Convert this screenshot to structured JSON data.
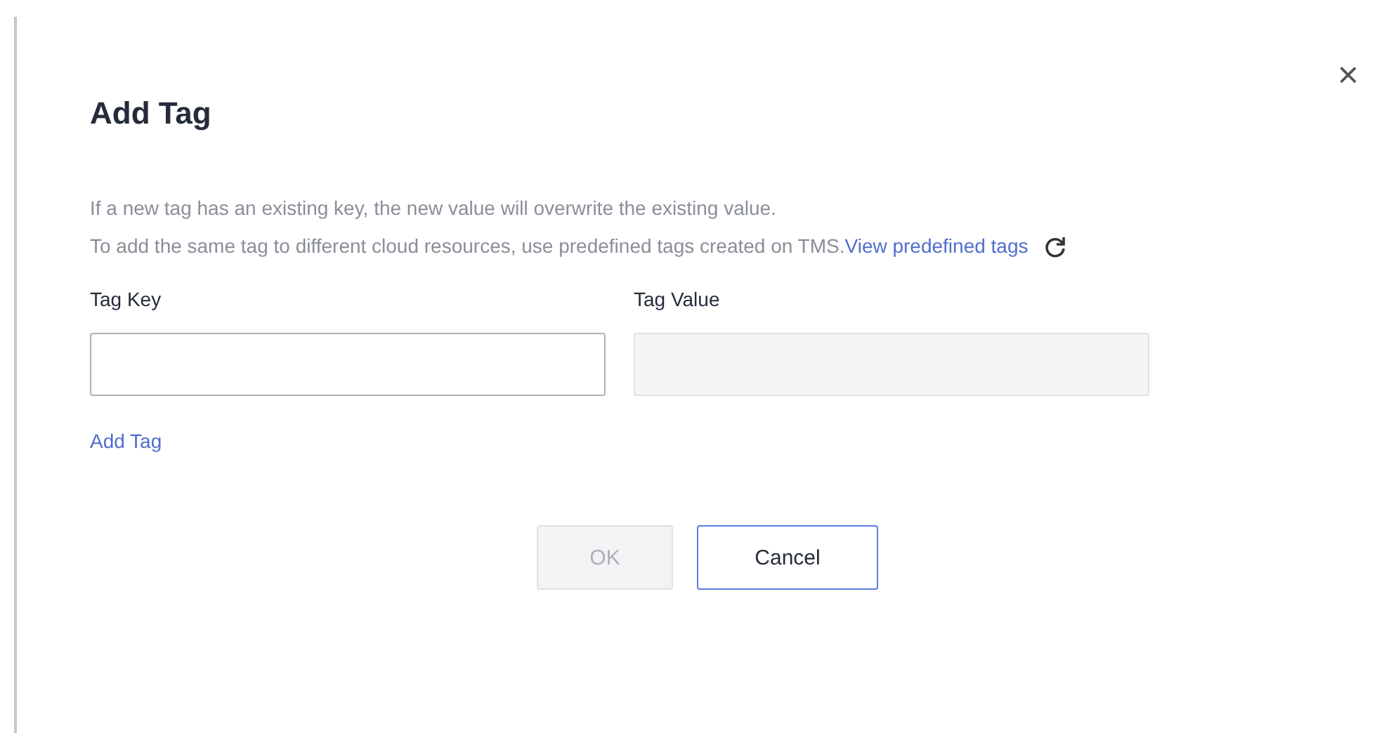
{
  "dialog": {
    "title": "Add Tag",
    "close": "×"
  },
  "notes": [
    {
      "text": "If a new tag has an existing key, the new value will overwrite the existing value."
    },
    {
      "text": "To add the same tag to different cloud resources, use predefined tags created on TMS.",
      "link": "View predefined tags"
    }
  ],
  "fields": [
    {
      "label": "Tag Key",
      "disabled": false
    },
    {
      "label": "Tag Value",
      "disabled": true
    }
  ],
  "add_link": "Add Tag",
  "buttons": [
    {
      "label": "OK",
      "disabled": true
    },
    {
      "label": "Cancel",
      "disabled": false
    }
  ]
}
